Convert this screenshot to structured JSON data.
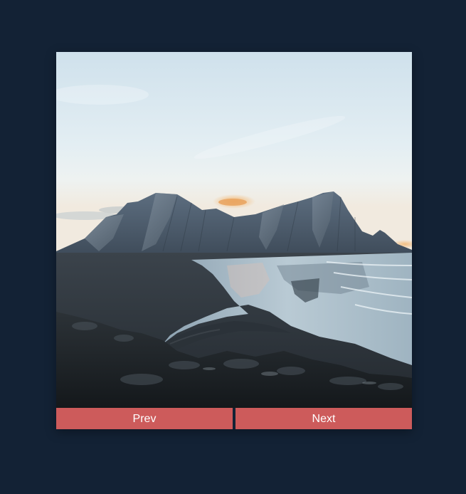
{
  "carousel": {
    "image": {
      "subject": "mountain-coast-photo"
    },
    "prev_label": "Prev",
    "next_label": "Next"
  },
  "colors": {
    "background": "#132235",
    "button": "#cd5b5b",
    "button_text": "#ffffff"
  }
}
